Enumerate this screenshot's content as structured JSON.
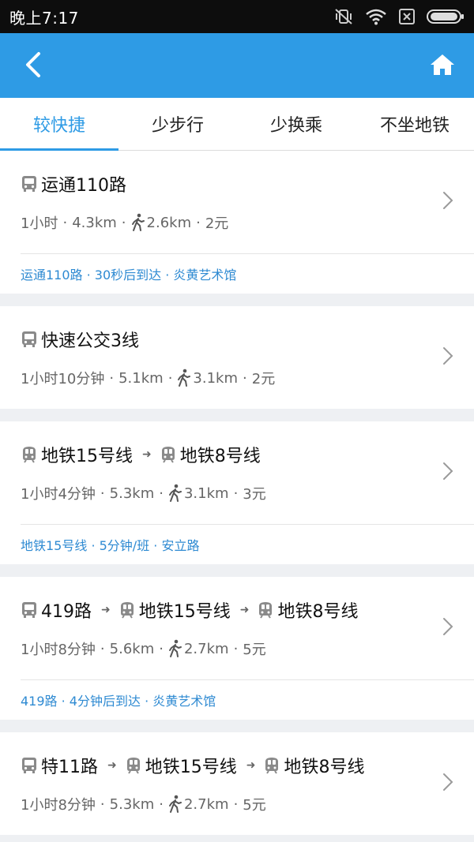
{
  "status_bar": {
    "time": "晚上7:17"
  },
  "tabs": [
    {
      "label": "较快捷",
      "active": true
    },
    {
      "label": "少步行",
      "active": false
    },
    {
      "label": "少换乘",
      "active": false
    },
    {
      "label": "不坐地铁",
      "active": false
    }
  ],
  "colors": {
    "accent": "#2e9be5",
    "hint_text": "#2e8ad2",
    "background": "#eef0f3"
  },
  "routes": [
    {
      "segments": [
        {
          "mode": "bus-icon",
          "name": "运通110路"
        }
      ],
      "duration": "1小时",
      "distance": "4.3km",
      "walk": "2.6km",
      "fare": "2元",
      "hint": "运通110路 · 30秒后到达 · 炎黄艺术馆"
    },
    {
      "segments": [
        {
          "mode": "bus-icon",
          "name": "快速公交3线"
        }
      ],
      "duration": "1小时10分钟",
      "distance": "5.1km",
      "walk": "3.1km",
      "fare": "2元",
      "hint": null
    },
    {
      "segments": [
        {
          "mode": "subway-icon",
          "name": "地铁15号线"
        },
        {
          "mode": "subway-icon",
          "name": "地铁8号线"
        }
      ],
      "duration": "1小时4分钟",
      "distance": "5.3km",
      "walk": "3.1km",
      "fare": "3元",
      "hint": "地铁15号线 · 5分钟/班 · 安立路"
    },
    {
      "segments": [
        {
          "mode": "bus-icon",
          "name": "419路"
        },
        {
          "mode": "subway-icon",
          "name": "地铁15号线"
        },
        {
          "mode": "subway-icon",
          "name": "地铁8号线"
        }
      ],
      "duration": "1小时8分钟",
      "distance": "5.6km",
      "walk": "2.7km",
      "fare": "5元",
      "hint": "419路 · 4分钟后到达 · 炎黄艺术馆"
    },
    {
      "segments": [
        {
          "mode": "bus-icon",
          "name": "特11路"
        },
        {
          "mode": "subway-icon",
          "name": "地铁15号线"
        },
        {
          "mode": "subway-icon",
          "name": "地铁8号线"
        }
      ],
      "duration": "1小时8分钟",
      "distance": "5.3km",
      "walk": "2.7km",
      "fare": "5元",
      "hint": null
    }
  ]
}
